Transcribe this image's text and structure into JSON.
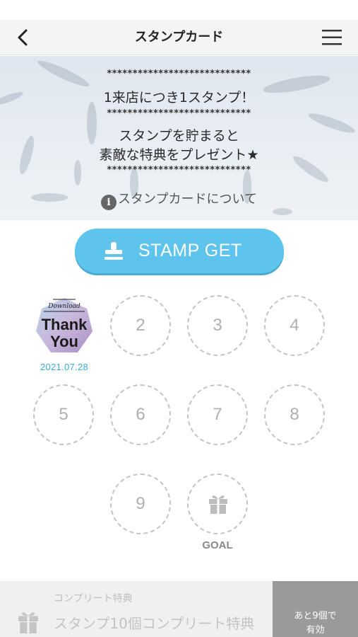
{
  "header": {
    "title": "スタンプカード"
  },
  "hero": {
    "stars": "****************************",
    "line1": "1来店につき1スタンプ！",
    "line2": "スタンプを貯まると",
    "line3": "素敵な特典をプレゼント★",
    "info_label": "スタンプカードについて"
  },
  "stamp_button": {
    "label": "STAMP GET"
  },
  "stamps": {
    "first": {
      "badge_top": "Download",
      "badge_main1": "Thank",
      "badge_main2": "You",
      "date": "2021.07.28"
    },
    "slots": [
      "2",
      "3",
      "4",
      "5",
      "6",
      "7",
      "8",
      "9"
    ],
    "goal_label": "GOAL"
  },
  "bottom": {
    "sub_label": "コンプリート特典",
    "title": "スタンプ10個コンプリート特典",
    "remain_line1": "あと9個で",
    "remain_line2": "有効"
  },
  "colors": {
    "accent": "#5ec4ee",
    "date": "#3aa9d9",
    "remain_bg": "#9a9a9a"
  }
}
